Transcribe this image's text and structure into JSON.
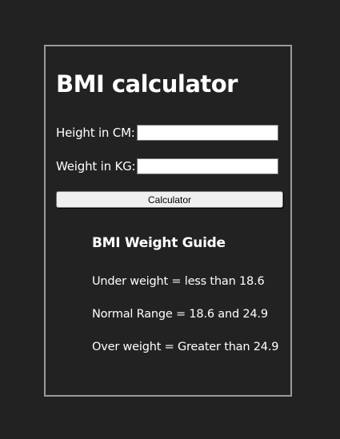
{
  "page": {
    "title": "BMI calculator"
  },
  "form": {
    "height_label": "Height in CM:",
    "height_value": "",
    "weight_label": "Weight in KG:",
    "weight_value": "",
    "button_label": "Calculator"
  },
  "guide": {
    "title": "BMI Weight Guide",
    "items": [
      "Under weight = less than 18.6",
      "Normal Range = 18.6 and 24.9",
      "Over weight = Greater than 24.9"
    ]
  },
  "colors": {
    "background": "#222222",
    "border": "#9a9a9a",
    "text": "#ffffff"
  }
}
